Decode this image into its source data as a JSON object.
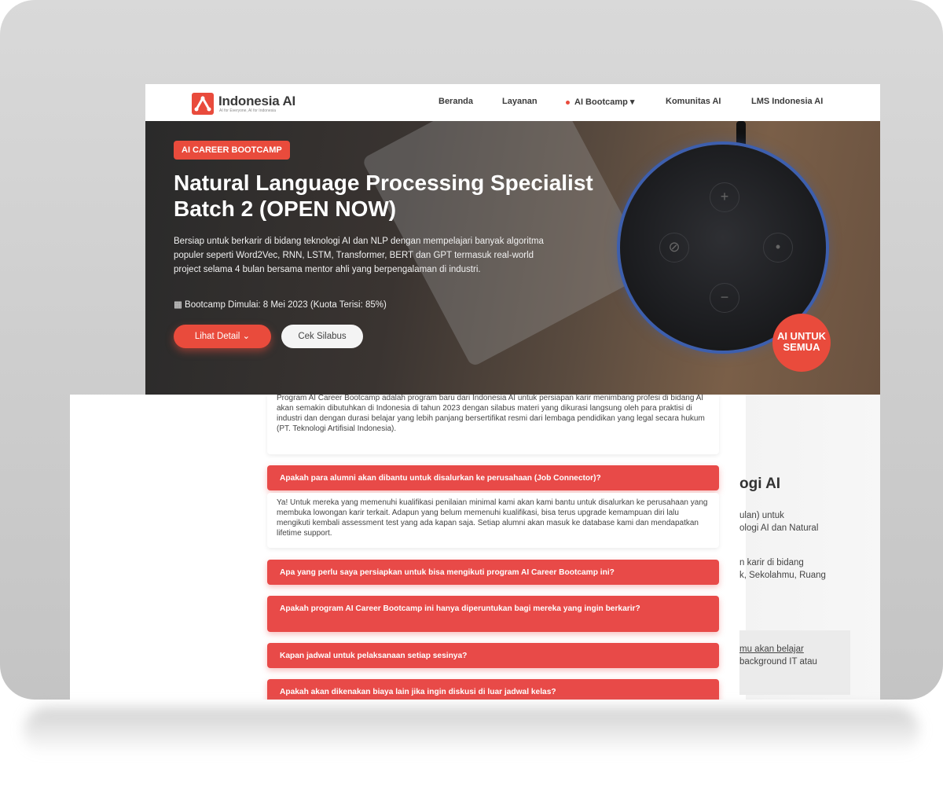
{
  "navbar": {
    "logo_name": "Indonesia AI",
    "logo_tagline": "AI for Everyone, AI for Indonesia",
    "menu": [
      "Beranda",
      "Layanan",
      "AI Bootcamp ▾",
      "Komunitas AI",
      "LMS Indonesia AI"
    ]
  },
  "hero": {
    "tag": "AI CAREER BOOTCAMP",
    "title": "Natural Language Processing Specialist Batch 2 (OPEN NOW)",
    "description": "Bersiap untuk berkarir di bidang teknologi AI dan NLP dengan mempelajari banyak algoritma populer seperti Word2Vec, RNN, LSTM, Transformer, BERT dan GPT termasuk real-world project selama 4 bulan bersama mentor ahli yang berpengalaman di industri.",
    "date_text": "▦ Bootcamp Dimulai: 8 Mei 2023 (Kuota Terisi: 85%)",
    "primary_button": "Lihat Detail ⌄",
    "secondary_button": "Cek Silabus",
    "sticker": "AI UNTUK SEMUA"
  },
  "faq": {
    "first_answer": "Program AI Career Bootcamp adalah program baru dari Indonesia AI untuk persiapan karir menimbang profesi di bidang AI akan semakin dibutuhkan di Indonesia di tahun 2023 dengan silabus materi yang dikurasi langsung oleh para praktisi di industri dan dengan durasi belajar yang lebih panjang bersertifikat resmi dari lembaga pendidikan yang legal secara hukum (PT. Teknologi Artifisial Indonesia).",
    "q1": "Apakah para alumni akan dibantu untuk disalurkan ke perusahaan (Job Connector)?",
    "a1": "Ya! Untuk mereka yang memenuhi kualifikasi penilaian minimal kami akan kami bantu untuk disalurkan ke perusahaan yang membuka lowongan karir terkait. Adapun yang belum memenuhi kualifikasi, bisa terus upgrade kemampuan diri lalu mengikuti kembali assessment test yang ada kapan saja. Setiap alumni akan masuk ke database kami dan mendapatkan lifetime support.",
    "q2": "Apa yang perlu saya persiapkan untuk bisa mengikuti program AI Career Bootcamp ini?",
    "q3": "Apakah program AI Career Bootcamp ini hanya diperuntukan bagi mereka yang ingin berkarir?",
    "q4": "Kapan jadwal untuk pelaksanaan setiap sesinya?",
    "q5": "Apakah akan dikenakan biaya lain jika ingin diskusi di luar jadwal kelas?"
  },
  "right_panel": {
    "heading": "ogi AI",
    "line1": "ulan) untuk",
    "line2": "ologi AI dan Natural",
    "line3": "n karir di bidang",
    "line4": "k, Sekolahmu, Ruang",
    "box_line1": "mu akan belajar",
    "box_line2": "background IT atau"
  },
  "colors": {
    "accent": "#e94b3c",
    "frame": "#d0d0d0"
  }
}
